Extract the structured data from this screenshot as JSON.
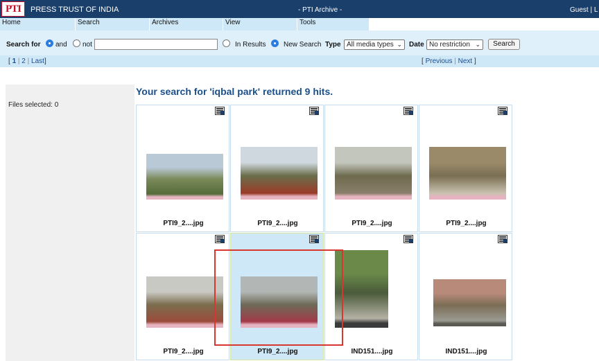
{
  "header": {
    "logo_text": "PTI",
    "brand": "PRESS TRUST OF INDIA",
    "title": "- PTI Archive -",
    "user": "Guest | L"
  },
  "menu": [
    "Home",
    "Search",
    "Archives",
    "View",
    "Tools"
  ],
  "search": {
    "label": "Search for",
    "and_label": "and",
    "not_label": "not",
    "query_value": "",
    "in_results_label": "In Results",
    "new_search_label": "New Search",
    "type_label": "Type",
    "type_value": "All media types",
    "date_label": "Date",
    "date_value": "No restriction",
    "button_label": "Search",
    "mode_selected": "and",
    "scope_selected": "New Search"
  },
  "pager": {
    "open": "[",
    "pages": [
      "1",
      "2"
    ],
    "last": "Last",
    "close": "]",
    "previous": "Previous",
    "next": "Next"
  },
  "left_panel": {
    "files_selected": "Files selected: 0"
  },
  "results": {
    "heading": "Your search for 'iqbal park' returned 9 hits.",
    "items": [
      {
        "filename": "PTI9_2....jpg",
        "selected": false,
        "thumb_colors": [
          "#b9c9d6",
          "#7b8a5a",
          "#556b3a",
          "#e6b3c0"
        ]
      },
      {
        "filename": "PTI9_2....jpg",
        "selected": false,
        "thumb_colors": [
          "#cfd8de",
          "#6a6d4a",
          "#9a3b2a",
          "#e6b3c0"
        ]
      },
      {
        "filename": "PTI9_2....jpg",
        "selected": false,
        "thumb_colors": [
          "#c3c6bd",
          "#6d6a4e",
          "#8a7f6b",
          "#e6b3c0"
        ]
      },
      {
        "filename": "PTI9_2....jpg",
        "selected": false,
        "thumb_colors": [
          "#9a8a6a",
          "#7a6e52",
          "#c9c2b0",
          "#e6b3c0"
        ]
      },
      {
        "filename": "PTI9_2....jpg",
        "selected": false,
        "thumb_colors": [
          "#c9c9c3",
          "#7b6d4e",
          "#9c4b3b",
          "#e6b3c0"
        ]
      },
      {
        "filename": "PTI9_2....jpg",
        "selected": true,
        "thumb_colors": [
          "#b2b7b5",
          "#6e6a58",
          "#a33a4a",
          "#e6b3c0"
        ]
      },
      {
        "filename": "IND151....jpg",
        "selected": false,
        "thumb_colors": [
          "#6b8a4a",
          "#4a5a3a",
          "#b5b2a5",
          "#3a3a3a"
        ]
      },
      {
        "filename": "IND151....jpg",
        "selected": false,
        "thumb_colors": [
          "#b88a7a",
          "#7b6d55",
          "#9a9a92",
          "#5a5a52"
        ]
      }
    ]
  },
  "colors": {
    "header_bg": "#1a3f6b",
    "menu_bg": "#cfe8f7",
    "search_bg": "#dff0fb",
    "heading": "#1a4f8c",
    "highlight_box": "#d9362f"
  }
}
